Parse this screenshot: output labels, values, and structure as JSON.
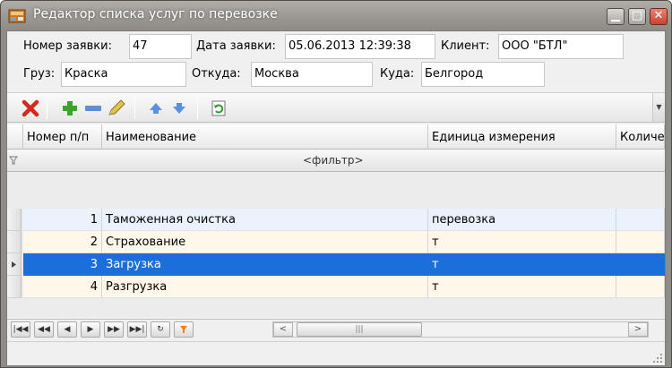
{
  "window": {
    "title": "Редактор списка услуг по перевозке"
  },
  "form": {
    "order_number": {
      "label": "Номер заявки:",
      "value": "47"
    },
    "order_date": {
      "label": "Дата заявки:",
      "value": "05.06.2013 12:39:38"
    },
    "client": {
      "label": "Клиент:",
      "value": "ООО \"БТЛ\""
    },
    "cargo": {
      "label": "Груз:",
      "value": "Краска"
    },
    "from": {
      "label": "Откуда:",
      "value": "Москва"
    },
    "to": {
      "label": "Куда:",
      "value": "Белгород"
    }
  },
  "toolbar": {
    "icons": [
      "delete-icon",
      "add-icon",
      "remove-icon",
      "edit-icon",
      "move-up-icon",
      "move-down-icon",
      "refresh-icon"
    ]
  },
  "grid": {
    "columns": [
      "Номер п/п",
      "Наименование",
      "Единица измерения",
      "Количе"
    ],
    "filter_text": "<фильтр>",
    "rows": [
      {
        "num": "1",
        "name": "Таможенная очистка",
        "unit": "перевозка"
      },
      {
        "num": "2",
        "name": "Страхование",
        "unit": "т"
      },
      {
        "num": "3",
        "name": "Загрузка",
        "unit": "т"
      },
      {
        "num": "4",
        "name": "Разгрузка",
        "unit": "т"
      }
    ],
    "selected_row": 2
  },
  "colors": {
    "selection": "#1a6fd8",
    "row_even": "#fff7e9",
    "row_odd": "#eaf3fd"
  }
}
